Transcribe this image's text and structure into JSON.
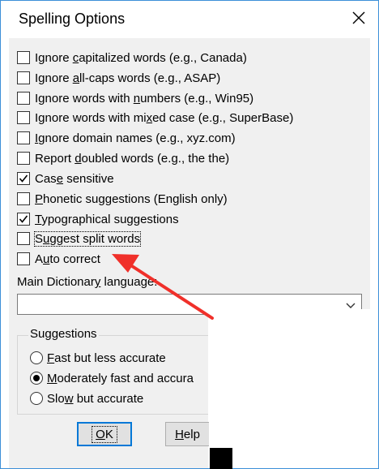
{
  "window": {
    "title": "Spelling Options",
    "close_glyph": "✕"
  },
  "options": [
    {
      "pre": "Ignore ",
      "key": "c",
      "post": "apitalized words (e.g., Canada)",
      "checked": false
    },
    {
      "pre": "Ignore ",
      "key": "a",
      "post": "ll-caps words (e.g., ASAP)",
      "checked": false
    },
    {
      "pre": "Ignore words with ",
      "key": "n",
      "post": "umbers (e.g., Win95)",
      "checked": false
    },
    {
      "pre": "Ignore words with mi",
      "key": "x",
      "post": "ed case (e.g., SuperBase)",
      "checked": false
    },
    {
      "pre": "",
      "key": "I",
      "post": "gnore domain names (e.g., xyz.com)",
      "checked": false
    },
    {
      "pre": "Report ",
      "key": "d",
      "post": "oubled words (e.g., the the)",
      "checked": false
    },
    {
      "pre": "Cas",
      "key": "e",
      "post": " sensitive",
      "checked": true
    },
    {
      "pre": "",
      "key": "P",
      "post": "honetic suggestions (English only)",
      "checked": false
    },
    {
      "pre": "",
      "key": "T",
      "post": "ypographical suggestions",
      "checked": true
    },
    {
      "pre": "S",
      "key": "u",
      "post": "ggest split words",
      "checked": false
    },
    {
      "pre": "A",
      "key": "u",
      "post": "to correct",
      "checked": false
    }
  ],
  "dictionary": {
    "label_pre": "Main Dictionar",
    "label_key": "y",
    "label_post": " language:",
    "value": ""
  },
  "suggestions": {
    "title": "Suggestions",
    "radios": [
      {
        "pre": "",
        "key": "F",
        "post": "ast but less accurate",
        "selected": false
      },
      {
        "pre": "",
        "key": "M",
        "post": "oderately fast and accura",
        "selected": true
      },
      {
        "pre": "Slo",
        "key": "w",
        "post": " but accurate",
        "selected": false
      }
    ]
  },
  "buttons": {
    "ok_key": "O",
    "ok_post": "K",
    "help_key": "H",
    "help_post": "elp"
  },
  "colors": {
    "accent": "#0078d7",
    "annotation": "#f0302a"
  }
}
